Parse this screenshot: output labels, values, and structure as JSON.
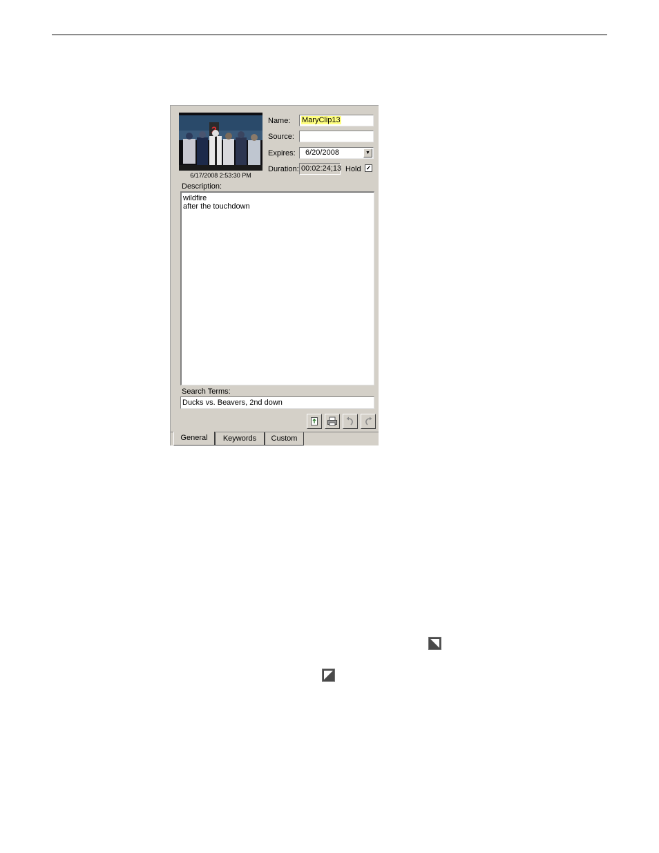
{
  "clip": {
    "thumbnail_timestamp": "6/17/2008 2:53:30 PM",
    "name_label": "Name:",
    "name_value": "MaryClip13",
    "source_label": "Source:",
    "source_value": "",
    "expires_label": "Expires:",
    "expires_value": "6/20/2008",
    "duration_label": "Duration:",
    "duration_value": "00:02:24;13",
    "hold_label": "Hold",
    "hold_checked": true
  },
  "description": {
    "label": "Description:",
    "lines": [
      "wildfire",
      "after the touchdown"
    ]
  },
  "search_terms": {
    "label": "Search Terms:",
    "value": "Ducks vs. Beavers, 2nd down"
  },
  "toolbar": {
    "icons": [
      "new-document-icon",
      "print-icon",
      "undo-icon",
      "redo-icon"
    ]
  },
  "tabs": [
    {
      "label": "General",
      "active": true
    },
    {
      "label": "Keywords",
      "active": false
    },
    {
      "label": "Custom",
      "active": false
    }
  ],
  "page_icons": [
    "expand-corner-icon",
    "collapse-corner-icon"
  ]
}
